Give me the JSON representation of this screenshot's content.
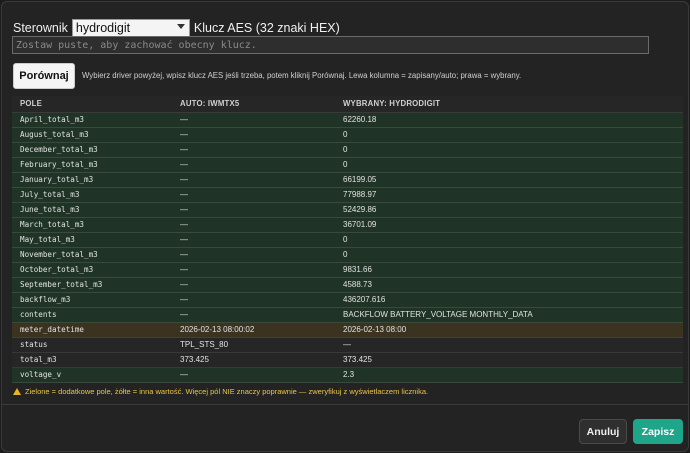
{
  "header": {
    "driver_label": "Sterownik",
    "driver_selected": "hydrodigit",
    "key_label": "Klucz AES (32 znaki HEX)",
    "key_placeholder": "Zostaw puste, aby zachować obecny klucz."
  },
  "actions": {
    "compare_label": "Porównaj",
    "hint": "Wybierz driver powyżej, wpisz klucz AES jeśli trzeba, potem kliknij Porównaj. Lewa kolumna = zapisany/auto; prawa = wybrany."
  },
  "table": {
    "headers": [
      "POLE",
      "AUTO: IWMTX5",
      "WYBRANY: HYDRODIGIT"
    ],
    "rows": [
      {
        "field": "April_total_m3",
        "auto": "—",
        "selected": "62260.18",
        "status": "green"
      },
      {
        "field": "August_total_m3",
        "auto": "—",
        "selected": "0",
        "status": "green"
      },
      {
        "field": "December_total_m3",
        "auto": "—",
        "selected": "0",
        "status": "green"
      },
      {
        "field": "February_total_m3",
        "auto": "—",
        "selected": "0",
        "status": "green"
      },
      {
        "field": "January_total_m3",
        "auto": "—",
        "selected": "66199.05",
        "status": "green"
      },
      {
        "field": "July_total_m3",
        "auto": "—",
        "selected": "77988.97",
        "status": "green"
      },
      {
        "field": "June_total_m3",
        "auto": "—",
        "selected": "52429.86",
        "status": "green"
      },
      {
        "field": "March_total_m3",
        "auto": "—",
        "selected": "36701.09",
        "status": "green"
      },
      {
        "field": "May_total_m3",
        "auto": "—",
        "selected": "0",
        "status": "green"
      },
      {
        "field": "November_total_m3",
        "auto": "—",
        "selected": "0",
        "status": "green"
      },
      {
        "field": "October_total_m3",
        "auto": "—",
        "selected": "9831.66",
        "status": "green"
      },
      {
        "field": "September_total_m3",
        "auto": "—",
        "selected": "4588.73",
        "status": "green"
      },
      {
        "field": "backflow_m3",
        "auto": "—",
        "selected": "436207.616",
        "status": "green"
      },
      {
        "field": "contents",
        "auto": "—",
        "selected": "BACKFLOW BATTERY_VOLTAGE MONTHLY_DATA",
        "status": "green"
      },
      {
        "field": "meter_datetime",
        "auto": "2026-02-13 08:00:02",
        "selected": "2026-02-13 08:00",
        "status": "yellow"
      },
      {
        "field": "status",
        "auto": "TPL_STS_80",
        "selected": "—",
        "status": "plain"
      },
      {
        "field": "total_m3",
        "auto": "373.425",
        "selected": "373.425",
        "status": "plain"
      },
      {
        "field": "voltage_v",
        "auto": "—",
        "selected": "2.3",
        "status": "green"
      }
    ]
  },
  "legend": "Zielone = dodatkowe pole, żółte = inna wartość. Więcej pól NIE znaczy poprawnie — zweryfikuj z wyświetlaczem licznika.",
  "footer": {
    "cancel_label": "Anuluj",
    "save_label": "Zapisz"
  },
  "colors": {
    "accent": "#1fa58a",
    "row_green": "#1f3426",
    "row_yellow": "#3b3220",
    "warning": "#e8c547"
  }
}
